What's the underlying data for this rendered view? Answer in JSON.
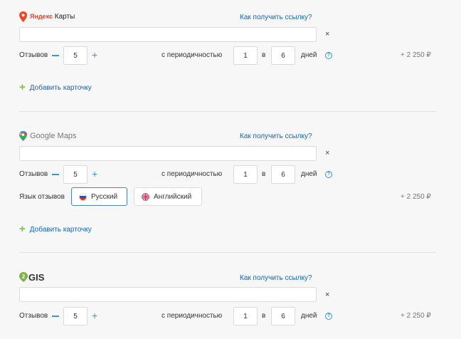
{
  "sections": {
    "yandex": {
      "logo_text": "Карты",
      "how_link": "Как получить ссылку?",
      "url_placeholder": "",
      "close": "×",
      "reviews_label": "Отзывов",
      "reviews_value": "5",
      "period_label": "с периодичностью",
      "period_a": "1",
      "period_in": "в",
      "period_b": "6",
      "days_label": "дней",
      "price": "+ 2 250 ₽",
      "add_card": "Добавить карточку"
    },
    "google": {
      "logo_text": "Google Maps",
      "how_link": "Как получить ссылку?",
      "url_placeholder": "",
      "close": "×",
      "reviews_label": "Отзывов",
      "reviews_value": "5",
      "period_label": "с периодичностью",
      "period_a": "1",
      "period_in": "в",
      "period_b": "6",
      "days_label": "дней",
      "lang_label": "Язык отзывов",
      "lang_options": [
        "Русский",
        "Английский"
      ],
      "lang_selected": "Русский",
      "price": "+ 2 250 ₽",
      "add_card": "Добавить карточку"
    },
    "twogis": {
      "logo_text": "GIS",
      "how_link": "Как получить ссылку?",
      "url_placeholder": "",
      "close": "×",
      "reviews_label": "Отзывов",
      "reviews_value": "5",
      "period_label": "с периодичностью",
      "period_a": "1",
      "period_in": "в",
      "period_b": "6",
      "days_label": "дней",
      "price": "+ 2 250 ₽"
    }
  },
  "colors": {
    "accent_blue": "#3a97d4",
    "link_blue": "#1565c0",
    "add_green": "#7cc242",
    "yandex_red": "#fc3f1d",
    "twogis_green": "#7cb342"
  },
  "icons": {
    "yandex": "map-pin-icon",
    "google": "google-maps-pin-icon",
    "twogis": "2gis-logo-icon",
    "close": "close-icon",
    "help": "help-icon",
    "add": "plus-icon",
    "minus": "minus-icon"
  }
}
